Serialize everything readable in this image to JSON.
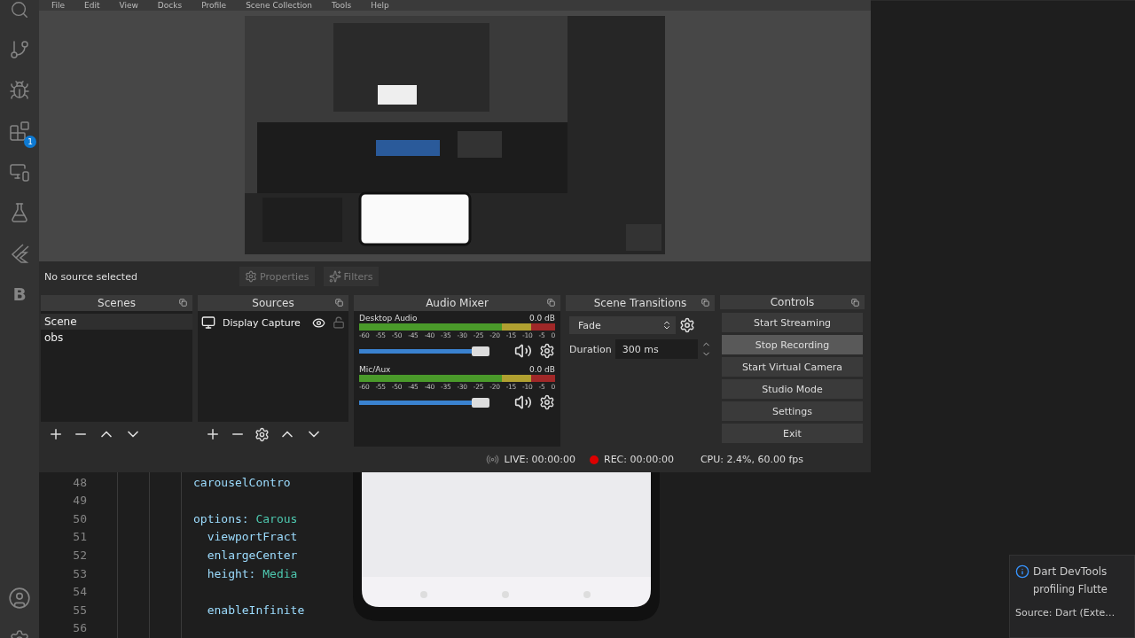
{
  "menu": [
    "File",
    "Edit",
    "View",
    "Docks",
    "Profile",
    "Scene Collection",
    "Tools",
    "Help"
  ],
  "activity_bar": {
    "extensions_badge": "1",
    "letter": "B"
  },
  "preview": {
    "kind": "picture"
  },
  "source_bar": {
    "label": "No source selected",
    "buttons": [
      {
        "label": "Properties",
        "disabled": true,
        "kind": "gear"
      },
      {
        "label": "Filters",
        "disabled": true,
        "kind": "filter"
      }
    ]
  },
  "scenes": {
    "title": "Scenes",
    "items": [
      {
        "label": "Scene",
        "selected": true
      },
      {
        "label": "obs",
        "selected": false
      }
    ]
  },
  "sources": {
    "title": "Sources",
    "items": [
      {
        "label": "Display Capture",
        "visible": true,
        "locked": false
      }
    ]
  },
  "audio_mixer": {
    "title": "Audio Mixer",
    "channels": [
      {
        "name": "Desktop Audio",
        "reading": "0.0 dB",
        "level": 0.93,
        "ticks": [
          "-60",
          "-55",
          "-50",
          "-45",
          "-40",
          "-35",
          "-30",
          "-25",
          "-20",
          "-15",
          "-10",
          "-5",
          "0"
        ]
      },
      {
        "name": "Mic/Aux",
        "reading": "0.0 dB",
        "level": 0.93,
        "ticks": [
          "-60",
          "-55",
          "-50",
          "-45",
          "-40",
          "-35",
          "-30",
          "-25",
          "-20",
          "-15",
          "-10",
          "-5",
          "0"
        ]
      }
    ]
  },
  "scene_transitions": {
    "title": "Scene Transitions",
    "transition": "Fade",
    "duration_label": "Duration",
    "duration": "300 ms"
  },
  "controls": {
    "title": "Controls",
    "buttons": [
      {
        "label": "Start Streaming",
        "hovered": false
      },
      {
        "label": "Stop Recording",
        "hovered": true
      },
      {
        "label": "Start Virtual Camera",
        "hovered": false
      },
      {
        "label": "Studio Mode",
        "hovered": false
      },
      {
        "label": "Settings",
        "hovered": false
      },
      {
        "label": "Exit",
        "hovered": false
      }
    ]
  },
  "status_bar": {
    "live": "LIVE: 00:00:00",
    "rec": "REC: 00:00:00",
    "cpu": "CPU: 2.4%, 60.00 fps"
  },
  "editor": {
    "lines": [
      {
        "number": "48",
        "tokens": [
          {
            "text": "carouselContro",
            "kind": "ident"
          }
        ]
      },
      {
        "number": "49"
      },
      {
        "number": "50",
        "tokens": [
          {
            "text": "options: ",
            "kind": "ident"
          },
          {
            "text": "Carous",
            "kind": "type"
          }
        ]
      },
      {
        "number": "51",
        "tokens": [
          {
            "text": "  viewportFract",
            "kind": "ident"
          }
        ]
      },
      {
        "number": "52",
        "tokens": [
          {
            "text": "  enlargeCenter",
            "kind": "ident"
          }
        ]
      },
      {
        "number": "53",
        "tokens": [
          {
            "text": "  height: ",
            "kind": "ident"
          },
          {
            "text": "Media",
            "kind": "type"
          }
        ]
      },
      {
        "number": "54"
      },
      {
        "number": "55",
        "tokens": [
          {
            "text": "  enableInfinite",
            "kind": "ident"
          }
        ]
      },
      {
        "number": "56"
      }
    ]
  },
  "notification": {
    "title": "Dart DevTools",
    "body": "profiling Flutte",
    "source": "Source: Dart (Exte…"
  }
}
